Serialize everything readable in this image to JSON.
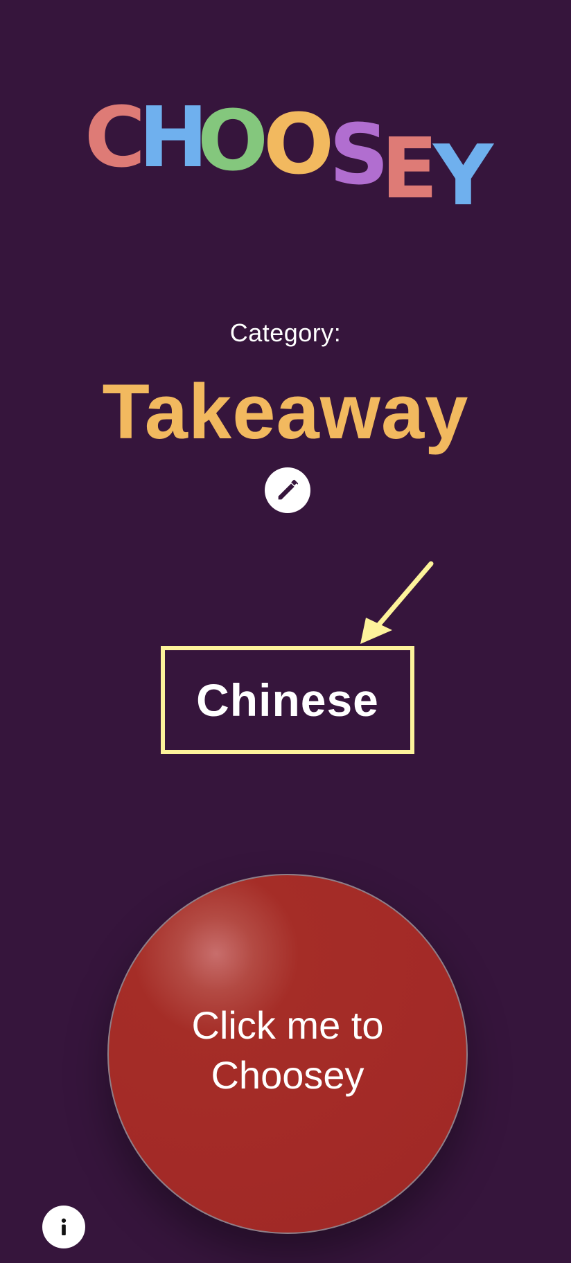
{
  "app": {
    "logo_text": "CHOOSEY",
    "logo_colors": [
      "#de7b76",
      "#6fb0ee",
      "#84c77d",
      "#f2b95f",
      "#f2b95f",
      "#b16ed0",
      "#de7b76",
      "#6fb0ee"
    ]
  },
  "category": {
    "label": "Category:",
    "value": "Takeaway",
    "value_color": "#f2b95f",
    "edit_icon": "pencil-icon"
  },
  "result": {
    "text": "Chinese",
    "highlight_color": "#fdf39b"
  },
  "action": {
    "line1": "Click me to",
    "line2": "Choosey",
    "button_color": "#a32a27"
  },
  "footer": {
    "info_icon": "info-icon"
  },
  "colors": {
    "background": "#36153c"
  }
}
